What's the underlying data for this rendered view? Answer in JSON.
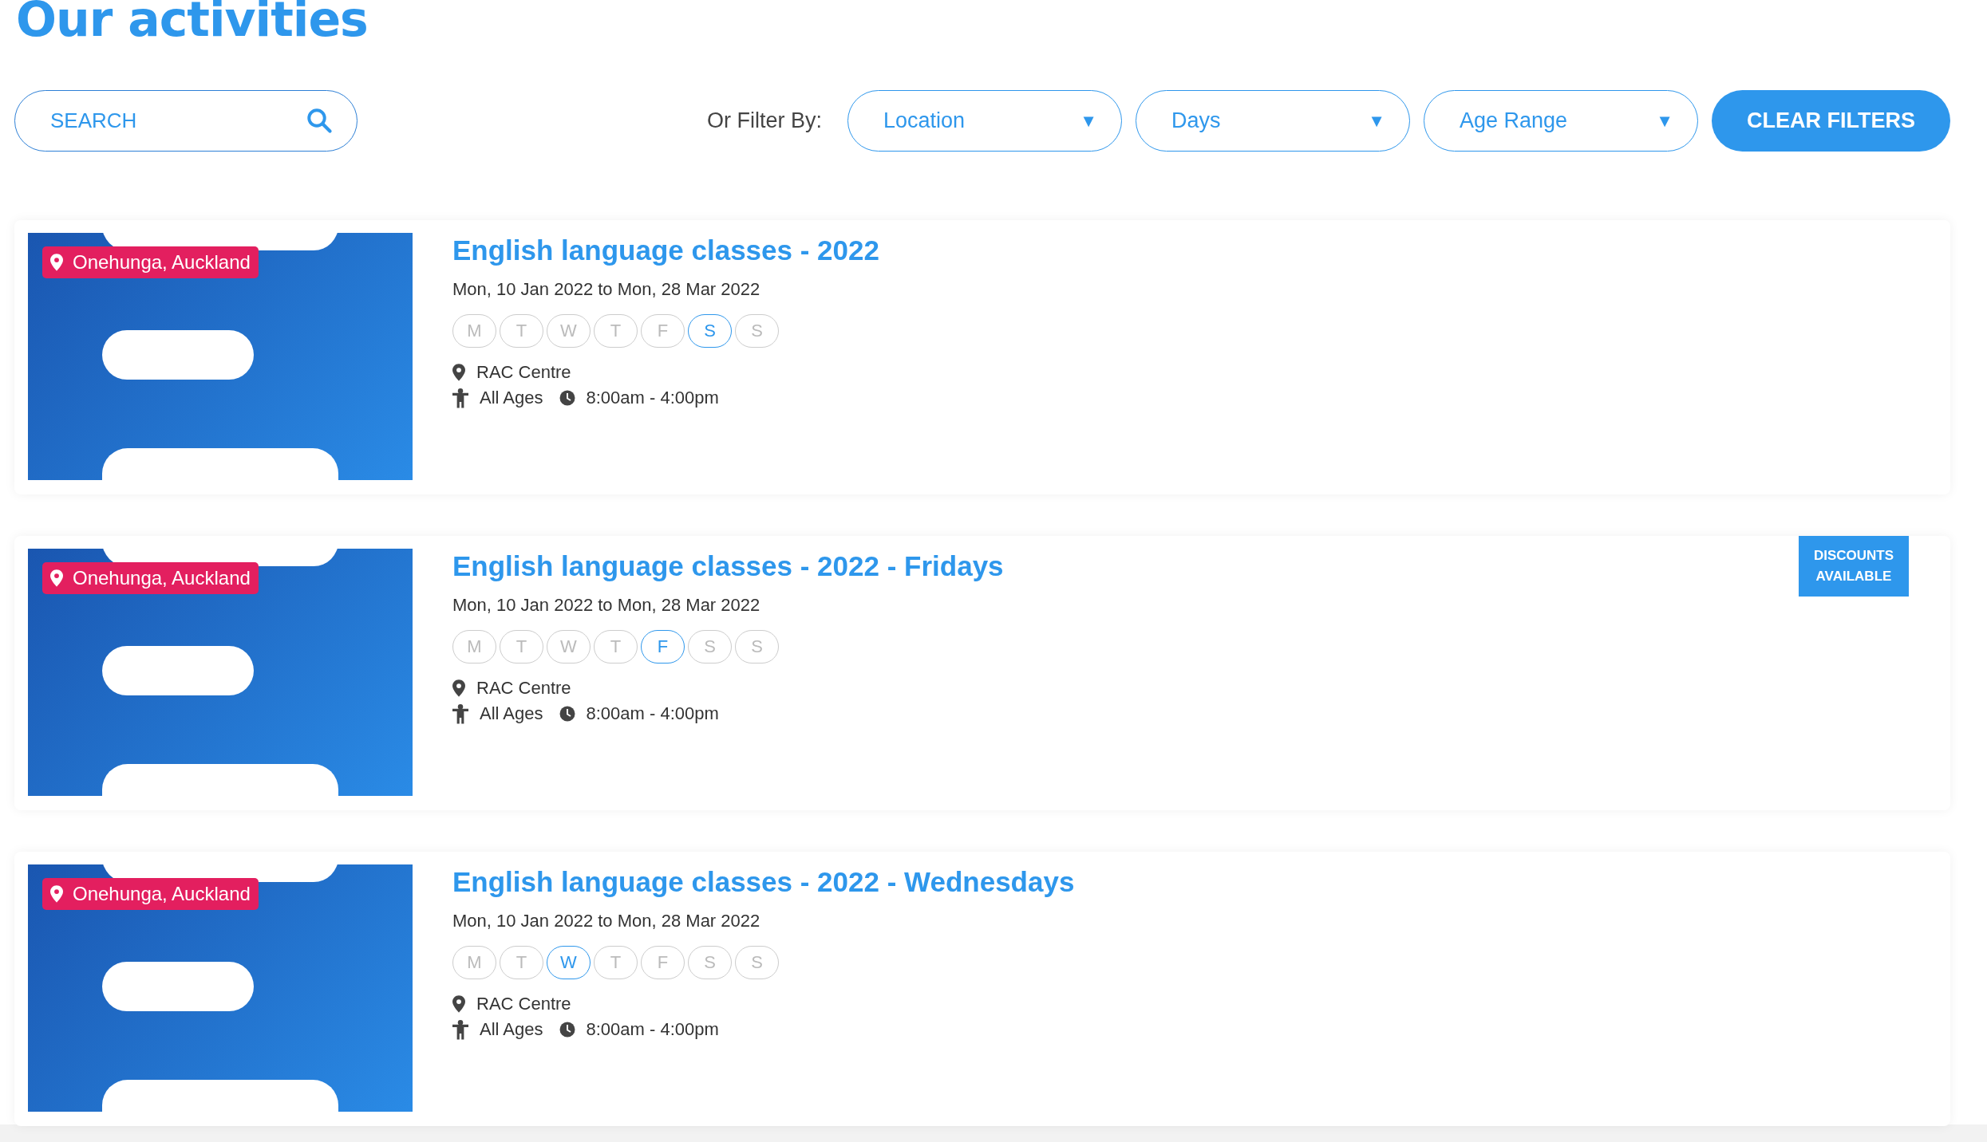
{
  "heading": "Our activities",
  "search": {
    "placeholder": "SEARCH"
  },
  "filter_label": "Or Filter By:",
  "filters": [
    {
      "label": "Location",
      "caret": "▼"
    },
    {
      "label": "Days",
      "caret": "▼"
    },
    {
      "label": "Age Range",
      "caret": "▼"
    }
  ],
  "clear_button": "CLEAR FILTERS",
  "activities": [
    {
      "location_tag": "Onehunga, Auckland",
      "title": "English language classes - 2022",
      "dates": "Mon, 10 Jan 2022 to Mon, 28 Mar 2022",
      "days": [
        {
          "label": "M",
          "selected": false
        },
        {
          "label": "T",
          "selected": false
        },
        {
          "label": "W",
          "selected": false
        },
        {
          "label": "T",
          "selected": false
        },
        {
          "label": "F",
          "selected": false
        },
        {
          "label": "S",
          "selected": true
        },
        {
          "label": "S",
          "selected": false
        }
      ],
      "venue": "RAC Centre",
      "ages": "All Ages",
      "time": "8:00am - 4:00pm"
    },
    {
      "location_tag": "Onehunga, Auckland",
      "title": "English language classes - 2022 - Fridays",
      "dates": "Mon, 10 Jan 2022 to Mon, 28 Mar 2022",
      "days": [
        {
          "label": "M",
          "selected": false
        },
        {
          "label": "T",
          "selected": false
        },
        {
          "label": "W",
          "selected": false
        },
        {
          "label": "T",
          "selected": false
        },
        {
          "label": "F",
          "selected": true
        },
        {
          "label": "S",
          "selected": false
        },
        {
          "label": "S",
          "selected": false
        }
      ],
      "venue": "RAC Centre",
      "ages": "All Ages",
      "time": "8:00am - 4:00pm",
      "badge": "DISCOUNTS AVAILABLE"
    },
    {
      "location_tag": "Onehunga, Auckland",
      "title": "English language classes - 2022 - Wednesdays",
      "dates": "Mon, 10 Jan 2022 to Mon, 28 Mar 2022",
      "days": [
        {
          "label": "M",
          "selected": false
        },
        {
          "label": "T",
          "selected": false
        },
        {
          "label": "W",
          "selected": true
        },
        {
          "label": "T",
          "selected": false
        },
        {
          "label": "F",
          "selected": false
        },
        {
          "label": "S",
          "selected": false
        },
        {
          "label": "S",
          "selected": false
        }
      ],
      "venue": "RAC Centre",
      "ages": "All Ages",
      "time": "8:00am - 4:00pm"
    }
  ]
}
